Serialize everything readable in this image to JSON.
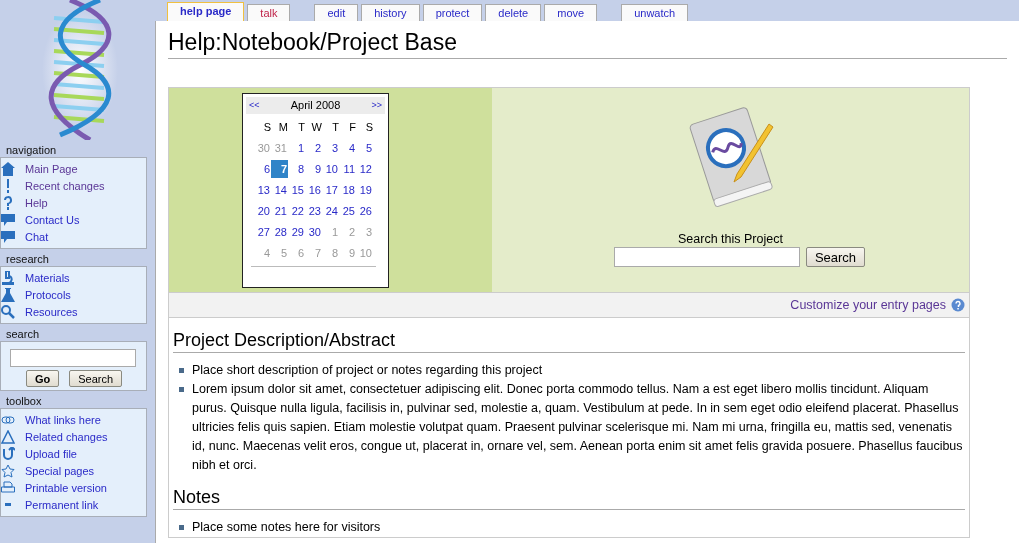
{
  "tab_groups": [
    [
      {
        "label": "help page",
        "selected": true,
        "missing": false
      },
      {
        "label": "talk",
        "selected": false,
        "missing": true
      }
    ],
    [
      {
        "label": "edit",
        "selected": false,
        "missing": false
      },
      {
        "label": "history",
        "selected": false,
        "missing": false
      },
      {
        "label": "protect",
        "selected": false,
        "missing": false
      },
      {
        "label": "delete",
        "selected": false,
        "missing": false
      },
      {
        "label": "move",
        "selected": false,
        "missing": false
      }
    ],
    [
      {
        "label": "unwatch",
        "selected": false,
        "missing": false
      }
    ]
  ],
  "sidebar": {
    "portlets": [
      {
        "title": "navigation",
        "kind": "links",
        "items": [
          {
            "label": "Main Page",
            "kind": "house",
            "visited": true
          },
          {
            "label": "Recent changes",
            "kind": "exclaim",
            "visited": true
          },
          {
            "label": "Help",
            "kind": "question",
            "visited": true
          },
          {
            "label": "Contact Us",
            "kind": "chat",
            "visited": false
          },
          {
            "label": "Chat",
            "kind": "chat",
            "visited": false
          }
        ]
      },
      {
        "title": "research",
        "kind": "links",
        "items": [
          {
            "label": "Materials",
            "kind": "microscope",
            "visited": false
          },
          {
            "label": "Protocols",
            "kind": "flask",
            "visited": false
          },
          {
            "label": "Resources",
            "kind": "magnifier",
            "visited": false
          }
        ]
      },
      {
        "title": "search",
        "kind": "search",
        "buttons": [
          "Go",
          "Search"
        ]
      },
      {
        "title": "toolbox",
        "kind": "links",
        "items": [
          {
            "label": "What links here",
            "kind": "chain",
            "visited": false
          },
          {
            "label": "Related changes",
            "kind": "triangle",
            "visited": false
          },
          {
            "label": "Upload file",
            "kind": "upload",
            "visited": false
          },
          {
            "label": "Special pages",
            "kind": "star",
            "visited": false
          },
          {
            "label": "Printable version",
            "kind": "printer",
            "visited": false
          },
          {
            "label": "Permanent link",
            "kind": "dash",
            "visited": false
          }
        ]
      }
    ]
  },
  "title": "Help:Notebook/Project Base",
  "calendar": {
    "prev": "<<",
    "month": "April 2008",
    "next": ">>",
    "weekdays": [
      "S",
      "M",
      "T",
      "W",
      "T",
      "F",
      "S"
    ],
    "weeks": [
      [
        {
          "day": "30",
          "other": true,
          "selected": false
        },
        {
          "day": "31",
          "other": true,
          "selected": false
        },
        {
          "day": "1",
          "other": false,
          "selected": false
        },
        {
          "day": "2",
          "other": false,
          "selected": false
        },
        {
          "day": "3",
          "other": false,
          "selected": false
        },
        {
          "day": "4",
          "other": false,
          "selected": false
        },
        {
          "day": "5",
          "other": false,
          "selected": false
        }
      ],
      [
        {
          "day": "6",
          "other": false,
          "selected": false
        },
        {
          "day": "7",
          "other": false,
          "selected": true
        },
        {
          "day": "8",
          "other": false,
          "selected": false
        },
        {
          "day": "9",
          "other": false,
          "selected": false
        },
        {
          "day": "10",
          "other": false,
          "selected": false
        },
        {
          "day": "11",
          "other": false,
          "selected": false
        },
        {
          "day": "12",
          "other": false,
          "selected": false
        }
      ],
      [
        {
          "day": "13",
          "other": false,
          "selected": false
        },
        {
          "day": "14",
          "other": false,
          "selected": false
        },
        {
          "day": "15",
          "other": false,
          "selected": false
        },
        {
          "day": "16",
          "other": false,
          "selected": false
        },
        {
          "day": "17",
          "other": false,
          "selected": false
        },
        {
          "day": "18",
          "other": false,
          "selected": false
        },
        {
          "day": "19",
          "other": false,
          "selected": false
        }
      ],
      [
        {
          "day": "20",
          "other": false,
          "selected": false
        },
        {
          "day": "21",
          "other": false,
          "selected": false
        },
        {
          "day": "22",
          "other": false,
          "selected": false
        },
        {
          "day": "23",
          "other": false,
          "selected": false
        },
        {
          "day": "24",
          "other": false,
          "selected": false
        },
        {
          "day": "25",
          "other": false,
          "selected": false
        },
        {
          "day": "26",
          "other": false,
          "selected": false
        }
      ],
      [
        {
          "day": "27",
          "other": false,
          "selected": false
        },
        {
          "day": "28",
          "other": false,
          "selected": false
        },
        {
          "day": "29",
          "other": false,
          "selected": false
        },
        {
          "day": "30",
          "other": false,
          "selected": false
        },
        {
          "day": "1",
          "other": true,
          "selected": false
        },
        {
          "day": "2",
          "other": true,
          "selected": false
        },
        {
          "day": "3",
          "other": true,
          "selected": false
        }
      ],
      [
        {
          "day": "4",
          "other": true,
          "selected": false
        },
        {
          "day": "5",
          "other": true,
          "selected": false
        },
        {
          "day": "6",
          "other": true,
          "selected": false
        },
        {
          "day": "7",
          "other": true,
          "selected": false
        },
        {
          "day": "8",
          "other": true,
          "selected": false
        },
        {
          "day": "9",
          "other": true,
          "selected": false
        },
        {
          "day": "10",
          "other": true,
          "selected": false
        }
      ]
    ]
  },
  "project_search": {
    "label": "Search this Project",
    "button": "Search"
  },
  "customize_link": "Customize your entry pages",
  "sections": [
    {
      "heading": "Project Description/Abstract",
      "items": [
        "Place short description of project or notes regarding this project",
        "Lorem ipsum dolor sit amet, consectetuer adipiscing elit. Donec porta commodo tellus. Nam a est eget libero mollis tincidunt. Aliquam purus. Quisque nulla ligula, facilisis in, pulvinar sed, molestie a, quam. Vestibulum at pede. In in sem eget odio eleifend placerat. Phasellus ultricies felis quis sapien. Etiam molestie volutpat quam. Praesent pulvinar scelerisque mi. Nam mi urna, fringilla eu, mattis sed, venenatis id, nunc. Maecenas velit eros, congue ut, placerat in, ornare vel, sem. Aenean porta enim sit amet felis gravida posuere. Phasellus faucibus nibh et orci."
      ]
    },
    {
      "heading": "Notes",
      "items": [
        "Place some notes here for visitors"
      ]
    }
  ]
}
